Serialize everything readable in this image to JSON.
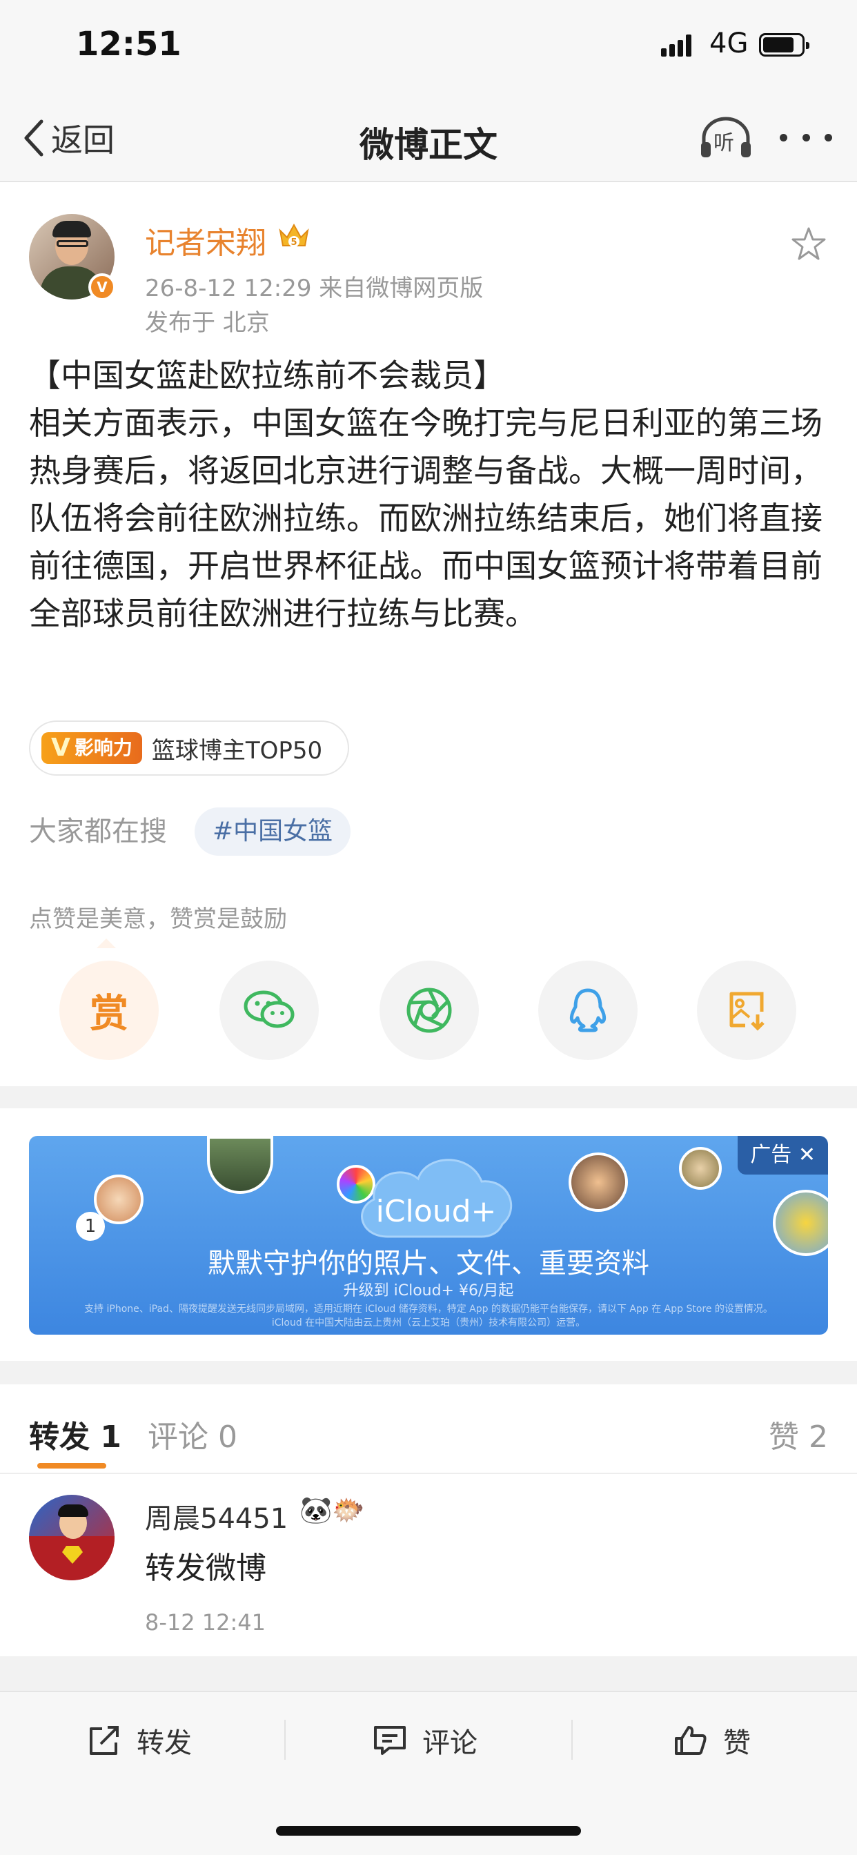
{
  "status_bar": {
    "time": "12:51",
    "network": "4G"
  },
  "nav": {
    "back_label": "返回",
    "title": "微博正文",
    "listen_label": "听"
  },
  "post": {
    "author": "记者宋翔",
    "verified_badge": "V",
    "crown_level": "5",
    "meta": "26-8-12 12:29  来自微博网页版",
    "location": "发布于 北京",
    "content_lines": [
      "【中国女篮赴欧拉练前不会裁员】",
      "相关方面表示，中国女篮在今晚打完与尼日利亚的第三场热身赛后，将返回北京进行调整与备战。大概一周时间，队伍将会前往欧洲拉练。而欧洲拉练结束后，她们将直接前往德国，开启世界杯征战。而中国女篮预计将带着目前全部球员前往欧洲进行拉练与比赛。"
    ],
    "influence_badge": "影响力",
    "influence_letter": "V",
    "influence_tag": "篮球博主TOP50",
    "search_label": "大家都在搜",
    "topic_tag": "#中国女篮",
    "reward_tip": "点赞是美意，赞赏是鼓励",
    "reward_button": "赏"
  },
  "ad": {
    "tag": "广告",
    "brand": "iCloud+",
    "headline": "默默守护你的照片、文件、重要资料",
    "sub": "升级到 iCloud+ ¥6/月起",
    "fine_print_1": "支持 iPhone、iPad、隔夜提醒发送无线同步局域网，适用近期在 iCloud 储存资料，特定 App 的数据仍能平台能保存，请以下 App 在 App Store 的设置情况。",
    "fine_print_2": "iCloud 在中国大陆由云上贵州（云上艾珀（贵州）技术有限公司）运营。",
    "pin_number": "1"
  },
  "tabs": {
    "repost": "转发 1",
    "comment": "评论 0",
    "like": "赞 2"
  },
  "reposts": [
    {
      "name": "周晨54451",
      "emoji": "🐼🐡",
      "text": "转发微博",
      "time": "8-12 12:41"
    }
  ],
  "bottom_bar": {
    "repost": "转发",
    "comment": "评论",
    "like": "赞"
  },
  "colors": {
    "accent": "#f08a24",
    "author": "#e8832e",
    "topic": "#4a6fa5",
    "ad_blue": "#3d86e0"
  }
}
